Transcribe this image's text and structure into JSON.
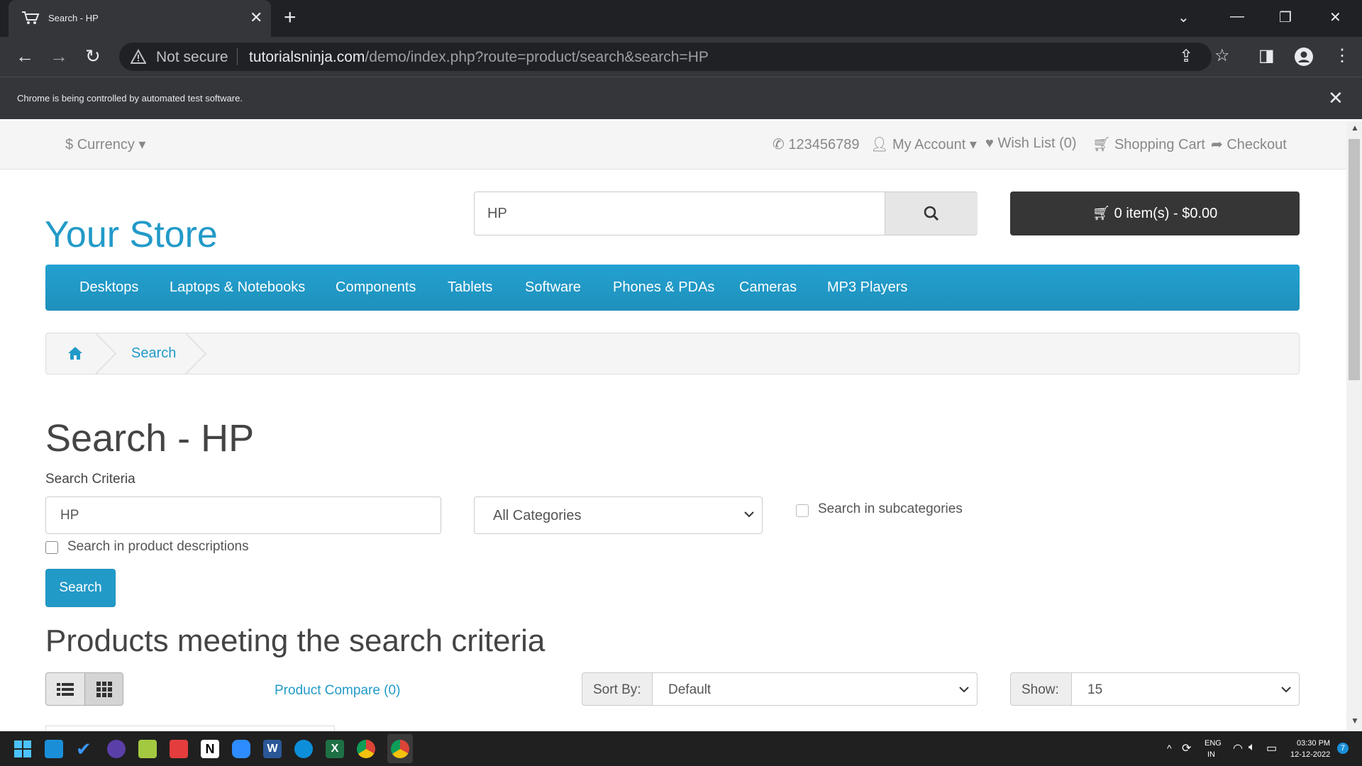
{
  "browser": {
    "tab_title": "Search - HP",
    "security_label": "Not secure",
    "url_host": "tutorialsninja.com",
    "url_path": "/demo/index.php?route=product/search&search=HP",
    "infobar_message": "Chrome is being controlled by automated test software."
  },
  "topbar": {
    "currency": "Currency",
    "phone": "123456789",
    "my_account": "My Account",
    "wishlist": "Wish List (0)",
    "shopping_cart": "Shopping Cart",
    "checkout": "Checkout"
  },
  "header": {
    "logo": "Your Store",
    "search_value": "HP",
    "cart": "0 item(s) - $0.00"
  },
  "menu": [
    "Desktops",
    "Laptops & Notebooks",
    "Components",
    "Tablets",
    "Software",
    "Phones & PDAs",
    "Cameras",
    "MP3 Players"
  ],
  "breadcrumb": {
    "current": "Search"
  },
  "main": {
    "title": "Search - HP",
    "criteria_label": "Search Criteria",
    "criteria_value": "HP",
    "category": "All Categories",
    "subcategories_label": "Search in subcategories",
    "descriptions_label": "Search in product descriptions",
    "search_button": "Search",
    "products_heading": "Products meeting the search criteria",
    "product_compare": "Product Compare (0)",
    "sort_by_label": "Sort By:",
    "sort_by_value": "Default",
    "show_label": "Show:",
    "show_value": "15"
  },
  "taskbar": {
    "lang": "ENG",
    "region": "IN",
    "time": "03:30 PM",
    "date": "12-12-2022",
    "notifications": "7"
  },
  "colors": {
    "accent": "#229ac8",
    "cart_button": "#363636"
  }
}
